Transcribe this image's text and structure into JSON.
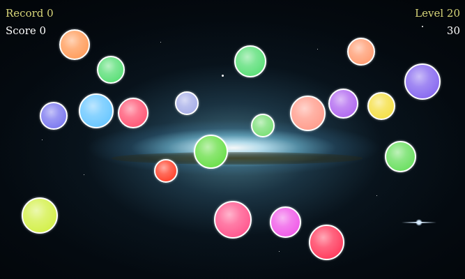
{
  "hud": {
    "record_label": "Record 0",
    "score_label": "Score 0",
    "level_label": "Level 20",
    "timer_value": "30"
  },
  "colors": {
    "hud_label": "#d8d67a",
    "hud_value": "#ffffff",
    "bubble_border": "#ffffff"
  },
  "bubbles": [
    {
      "color": "#ff9f5f"
    },
    {
      "color": "#5ee07a"
    },
    {
      "color": "#5ee07a"
    },
    {
      "color": "#ff9f75"
    },
    {
      "color": "#8a6cf0"
    },
    {
      "color": "#7f7cf0"
    },
    {
      "color": "#6cc8ff"
    },
    {
      "color": "#ff5a78"
    },
    {
      "color": "#a9b0e8"
    },
    {
      "color": "#ff9f8f"
    },
    {
      "color": "#b36cf0"
    },
    {
      "color": "#f5e04a"
    },
    {
      "color": "#7ee07a"
    },
    {
      "color": "#6ee04e"
    },
    {
      "color": "#6ee064"
    },
    {
      "color": "#ff4630"
    },
    {
      "color": "#d4f04e"
    },
    {
      "color": "#ff5a90"
    },
    {
      "color": "#f05ee8"
    },
    {
      "color": "#ff3f60"
    }
  ]
}
